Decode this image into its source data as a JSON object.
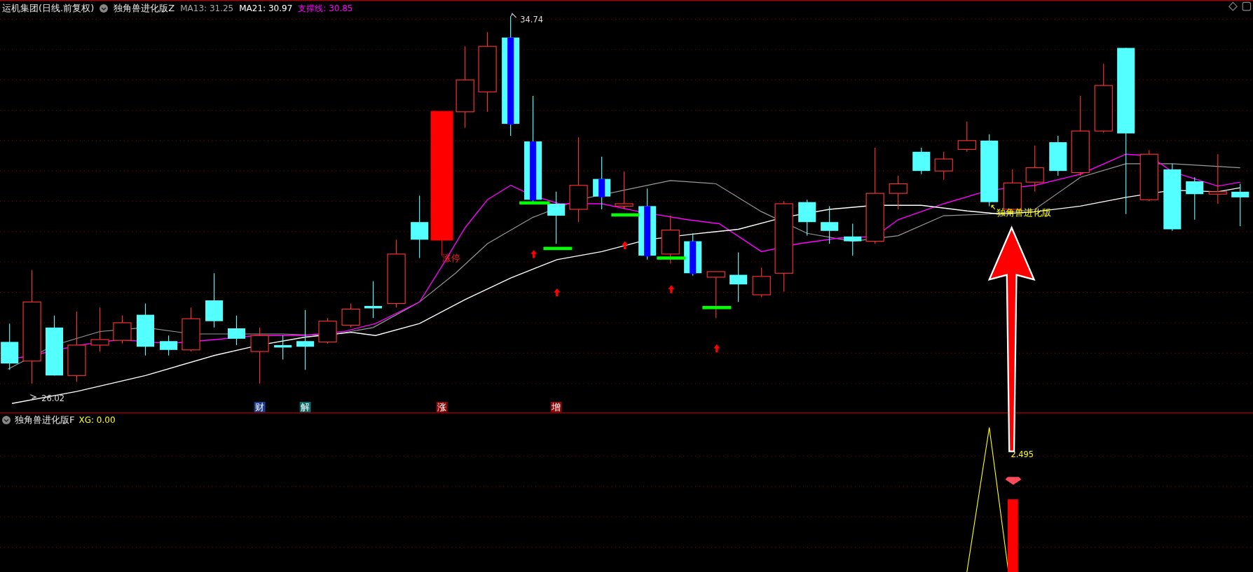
{
  "header": {
    "stock": "运机集团(日线.前复权)",
    "indicator": "独角兽进化版Z",
    "values": [
      {
        "label": "MA13: 31.25",
        "color": "#a8a8a8"
      },
      {
        "label": "MA21: 30.97",
        "color": "#ffffff"
      },
      {
        "label": "支撑线: 30.85",
        "color": "#ff00ff"
      }
    ]
  },
  "price_labels": {
    "high": "34.74",
    "low": "26.02"
  },
  "signal_labels": {
    "limit_up": "涨停",
    "indicator_name": "独角兽进化版"
  },
  "event_tags": [
    {
      "text": "财",
      "color": "#1e3c8c"
    },
    {
      "text": "解",
      "color": "#0e6e6e"
    },
    {
      "text": "涨",
      "color": "#8b0a0a"
    },
    {
      "text": "增",
      "color": "#8b0a0a"
    }
  ],
  "lower_panel": {
    "indicator": "独角兽进化版F",
    "values": [
      {
        "label": "XG: 0.00",
        "color": "#ffff00"
      }
    ],
    "peak_label": "2.495"
  }
}
